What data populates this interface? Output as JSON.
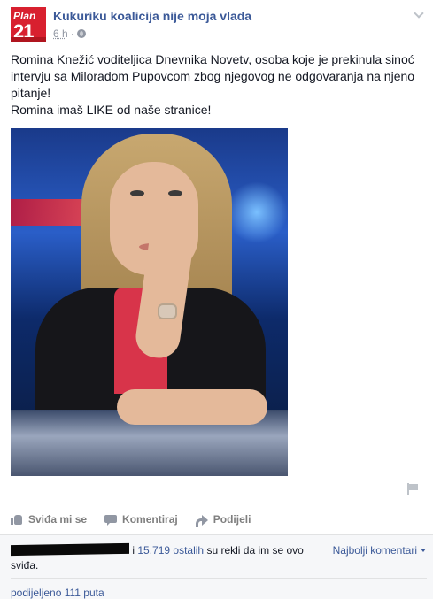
{
  "post": {
    "page_name": "Kukuriku koalicija nije moja vlada",
    "avatar_text_top": "Plan",
    "avatar_text_num": "21",
    "time": "6 h",
    "privacy_icon": "globe-icon",
    "text_line1": "Romina Knežić voditeljica Dnevnika Novetv, osoba koje je prekinula sinoć intervju sa Miloradom Pupovcom zbog njegovog ne odgovaranja na njeno pitanje!",
    "text_line2": "Romina imaš LIKE od naše stranice!"
  },
  "actions": {
    "like": "Sviđa mi se",
    "comment": "Komentiraj",
    "share": "Podijeli"
  },
  "feedback": {
    "likes_prefix": "i",
    "likes_count": "15.719",
    "others_label": "ostalih",
    "likes_suffix": "su rekli da im se ovo sviđa.",
    "best_comments": "Najbolji komentari",
    "shares": "podijeljeno 111 puta"
  },
  "colors": {
    "link": "#3b5998",
    "muted": "#9197a3",
    "avatar_red": "#d8202f"
  }
}
